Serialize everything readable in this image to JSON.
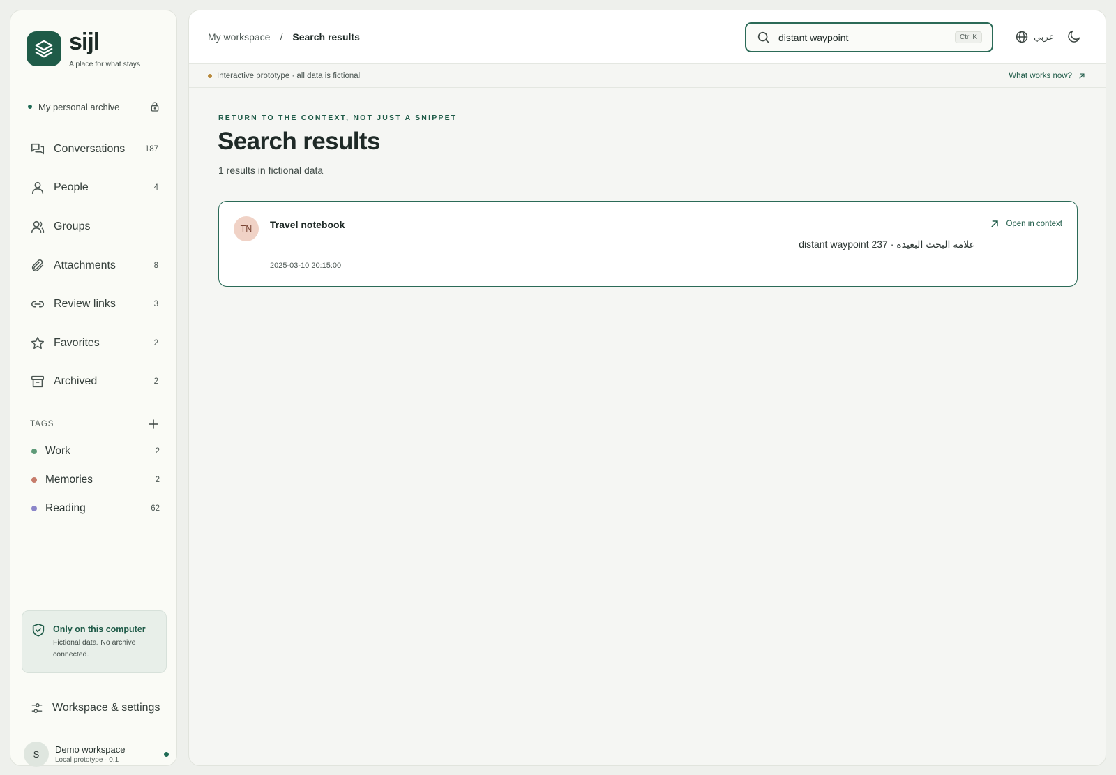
{
  "brand": {
    "name": "sijl",
    "tagline": "A place for what stays"
  },
  "archive": {
    "label": "My personal archive"
  },
  "nav": [
    {
      "label": "Conversations",
      "count": "187",
      "icon": "chat-bubbles-icon"
    },
    {
      "label": "People",
      "count": "4",
      "icon": "person-icon"
    },
    {
      "label": "Groups",
      "count": "",
      "icon": "group-icon"
    },
    {
      "label": "Attachments",
      "count": "8",
      "icon": "paperclip-icon"
    },
    {
      "label": "Review links",
      "count": "3",
      "icon": "link-icon"
    },
    {
      "label": "Favorites",
      "count": "2",
      "icon": "star-icon"
    },
    {
      "label": "Archived",
      "count": "2",
      "icon": "archive-box-icon"
    }
  ],
  "tags": {
    "heading": "TAGS",
    "items": [
      {
        "label": "Work",
        "count": "2",
        "color": "#5e9a78"
      },
      {
        "label": "Memories",
        "count": "2",
        "color": "#c67c6b"
      },
      {
        "label": "Reading",
        "count": "62",
        "color": "#8b86c9"
      }
    ]
  },
  "privacy": {
    "title": "Only on this computer",
    "description": "Fictional data. No archive connected."
  },
  "settings": {
    "label": "Workspace & settings"
  },
  "workspace": {
    "initial": "S",
    "name": "Demo workspace",
    "subtitle": "Local prototype · 0.1"
  },
  "breadcrumb": {
    "root": "My workspace",
    "separator": "/",
    "current": "Search results"
  },
  "search": {
    "value": "distant waypoint",
    "shortcut": "Ctrl K"
  },
  "language": {
    "label": "عربي"
  },
  "notice": {
    "text": "Interactive prototype · all data is fictional",
    "link": "What works now?"
  },
  "page": {
    "eyebrow": "RETURN TO THE CONTEXT, NOT JUST A SNIPPET",
    "title": "Search results",
    "results_count": "1 results in fictional data"
  },
  "results": [
    {
      "initials": "TN",
      "title": "Travel notebook",
      "snippet": "distant waypoint 237 · علامة البحث البعيدة",
      "date": "2025-03-10 20:15:00",
      "action": "Open in context"
    }
  ],
  "colors": {
    "accent": "#1f5b48",
    "card_border": "#2b6a57",
    "sidebar_bg": "#fafbf6",
    "page_bg": "#eef0ec"
  }
}
